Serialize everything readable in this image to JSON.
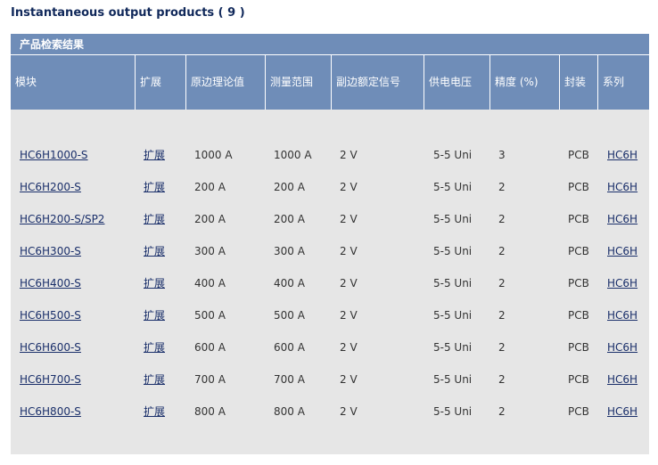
{
  "page": {
    "heading": "Instantaneous output products ( 9 )"
  },
  "panel": {
    "title": "产品检索结果"
  },
  "columns": [
    "模块",
    "扩展",
    "原边理论值",
    "测量范围",
    "副边额定信号",
    "供电电压",
    "精度 (%)",
    "封装",
    "系列"
  ],
  "rows": [
    {
      "model": "HC6H1000-S",
      "ext": "扩展",
      "ipn": "1000 A",
      "range": "1000 A",
      "signal": "2 V",
      "supply": "5-5 Uni",
      "accuracy": "3",
      "package": "PCB",
      "series": "HC6H"
    },
    {
      "model": "HC6H200-S",
      "ext": "扩展",
      "ipn": "200 A",
      "range": "200 A",
      "signal": "2 V",
      "supply": "5-5 Uni",
      "accuracy": "2",
      "package": "PCB",
      "series": "HC6H"
    },
    {
      "model": "HC6H200-S/SP2",
      "ext": "扩展",
      "ipn": "200 A",
      "range": "200 A",
      "signal": "2 V",
      "supply": "5-5 Uni",
      "accuracy": "2",
      "package": "PCB",
      "series": "HC6H"
    },
    {
      "model": "HC6H300-S",
      "ext": "扩展",
      "ipn": "300 A",
      "range": "300 A",
      "signal": "2 V",
      "supply": "5-5 Uni",
      "accuracy": "2",
      "package": "PCB",
      "series": "HC6H"
    },
    {
      "model": "HC6H400-S",
      "ext": "扩展",
      "ipn": "400 A",
      "range": "400 A",
      "signal": "2 V",
      "supply": "5-5 Uni",
      "accuracy": "2",
      "package": "PCB",
      "series": "HC6H"
    },
    {
      "model": "HC6H500-S",
      "ext": "扩展",
      "ipn": "500 A",
      "range": "500 A",
      "signal": "2 V",
      "supply": "5-5 Uni",
      "accuracy": "2",
      "package": "PCB",
      "series": "HC6H"
    },
    {
      "model": "HC6H600-S",
      "ext": "扩展",
      "ipn": "600 A",
      "range": "600 A",
      "signal": "2 V",
      "supply": "5-5 Uni",
      "accuracy": "2",
      "package": "PCB",
      "series": "HC6H"
    },
    {
      "model": "HC6H700-S",
      "ext": "扩展",
      "ipn": "700 A",
      "range": "700 A",
      "signal": "2 V",
      "supply": "5-5 Uni",
      "accuracy": "2",
      "package": "PCB",
      "series": "HC6H"
    },
    {
      "model": "HC6H800-S",
      "ext": "扩展",
      "ipn": "800 A",
      "range": "800 A",
      "signal": "2 V",
      "supply": "5-5 Uni",
      "accuracy": "2",
      "package": "PCB",
      "series": "HC6H"
    }
  ]
}
